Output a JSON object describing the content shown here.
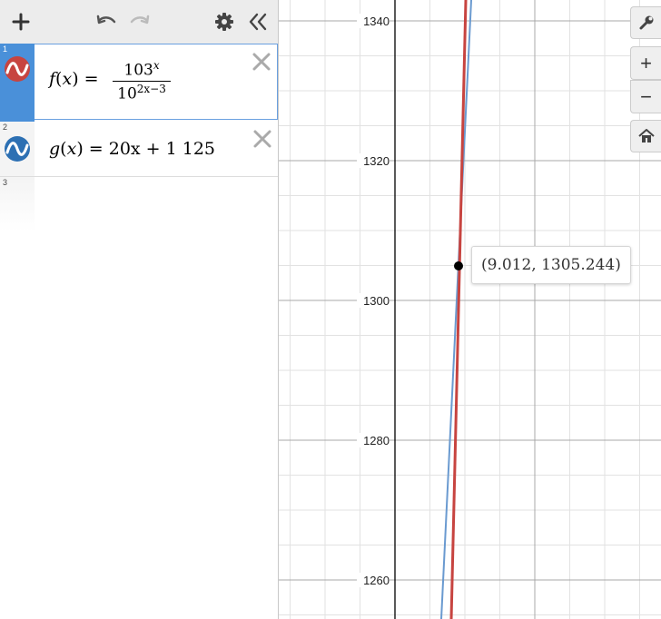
{
  "toolbar": {
    "add_icon": "plus-icon",
    "undo_icon": "undo-icon",
    "redo_icon": "redo-icon",
    "settings_icon": "gear-icon",
    "collapse_icon": "double-chevron-left-icon"
  },
  "expressions": [
    {
      "index": "1",
      "color": "#c74440",
      "fname": "f",
      "var": "x",
      "numerator_base": "103",
      "numerator_exp": "x",
      "denominator_base": "10",
      "denominator_exp": "2x−3"
    },
    {
      "index": "2",
      "color": "#2d70b3",
      "fname": "g",
      "var": "x",
      "rhs": "20x + 1 125"
    },
    {
      "index": "3"
    }
  ],
  "graph": {
    "y_ticks": [
      "1340",
      "1320",
      "1300",
      "1280",
      "1260"
    ],
    "point_label": "(9.012, 1305.244)",
    "grid": true
  },
  "controls": {
    "settings_icon": "wrench-icon",
    "zoom_in_label": "+",
    "zoom_out_label": "−",
    "home_icon": "home-icon"
  }
}
